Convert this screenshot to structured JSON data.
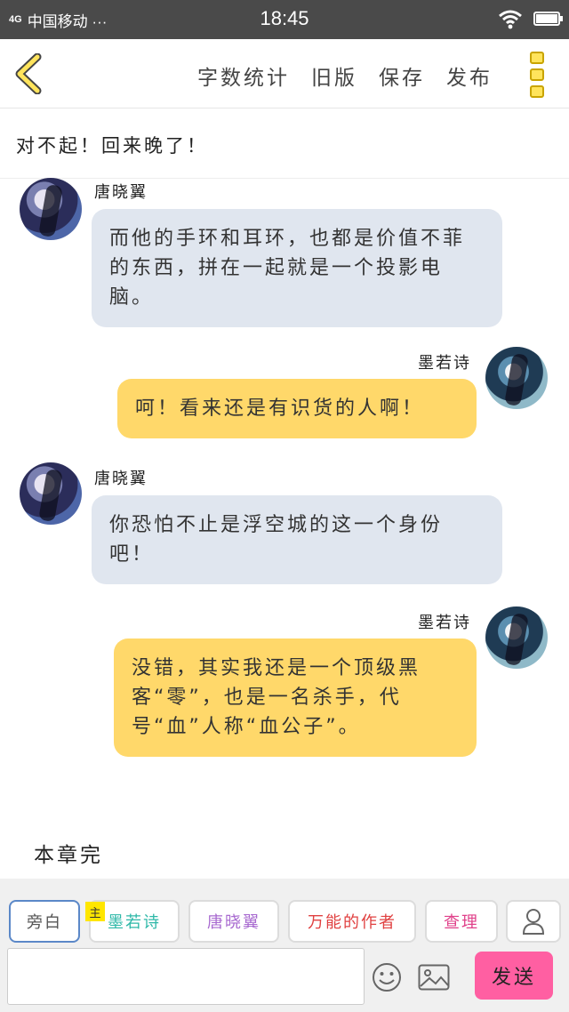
{
  "status_bar": {
    "signal": "4G",
    "carrier": "中国移动 ···",
    "time": "18:45"
  },
  "topbar": {
    "back_icon": "chevron-left-icon",
    "menu": [
      "字数统计",
      "旧版",
      "保存",
      "发布"
    ],
    "more_icon": "more-vertical-icon"
  },
  "chapter_title": "对不起！回来晚了！",
  "messages": [
    {
      "speaker": "唐晓翼",
      "side": "left",
      "text": "而他的手环和耳环，也都是价值不菲的东西，拼在一起就是一个投影电脑。"
    },
    {
      "speaker": "墨若诗",
      "side": "right",
      "text": "呵！看来还是有识货的人啊！"
    },
    {
      "speaker": "唐晓翼",
      "side": "left",
      "text": "你恐怕不止是浮空城的这一个身份吧！"
    },
    {
      "speaker": "墨若诗",
      "side": "right",
      "text": "没错，其实我还是一个顶级黑客“零”，也是一名杀手，代号“血”人称“血公子”。"
    }
  ],
  "end_text": "本章完",
  "roles": [
    {
      "label": "旁白",
      "color": "#555555"
    },
    {
      "label": "墨若诗",
      "color": "#2eb8a8",
      "tag": "主"
    },
    {
      "label": "唐晓翼",
      "color": "#a86ad0"
    },
    {
      "label": "万能的作者",
      "color": "#e04040"
    },
    {
      "label": "查理",
      "color": "#e0408a"
    }
  ],
  "input": {
    "value": "",
    "placeholder": ""
  },
  "icons": {
    "user": "user-icon",
    "emoji": "emoji-icon",
    "image": "image-icon"
  },
  "send_label": "发送",
  "colors": {
    "accent": "#ff5fa2",
    "bubble_left": "#e0e6ef",
    "bubble_right": "#ffd86a",
    "menu_icon": "#ffe45c"
  }
}
